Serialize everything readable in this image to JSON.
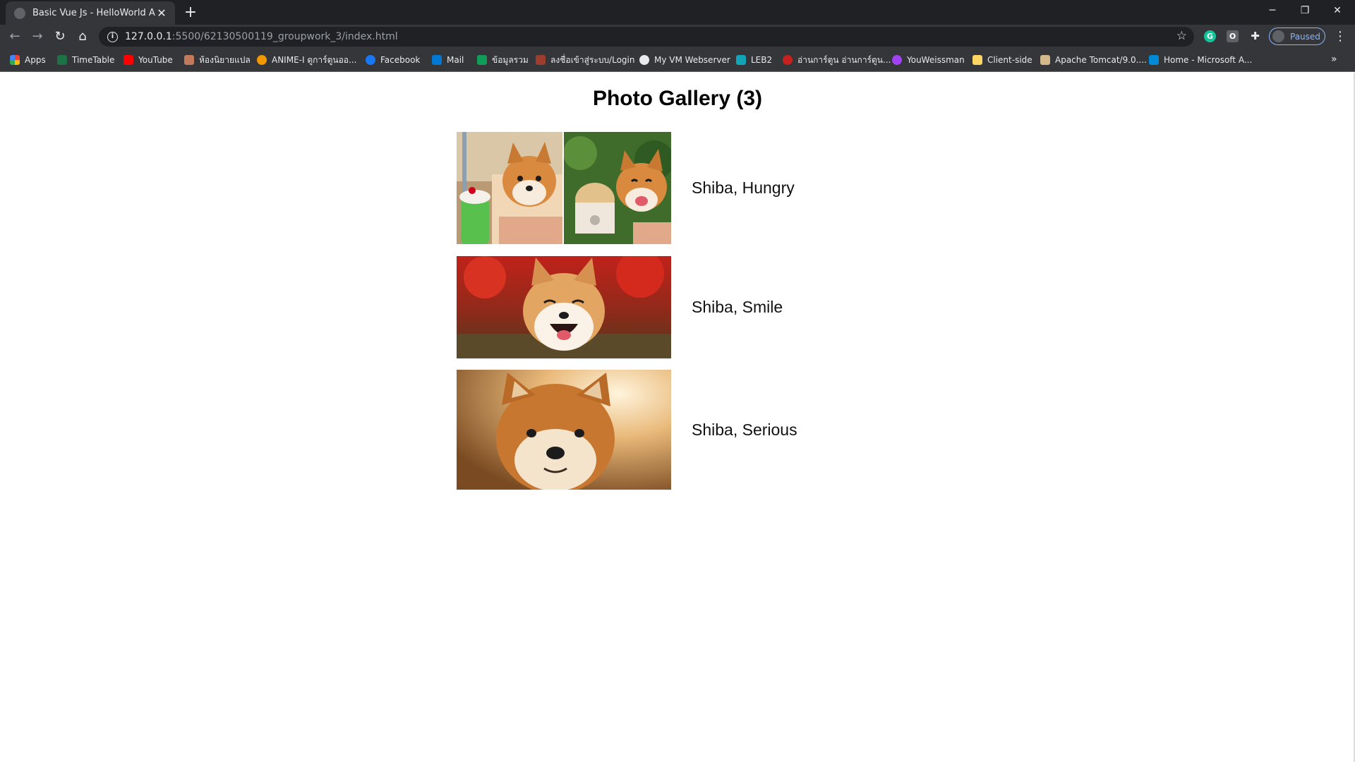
{
  "browser": {
    "tab_title": "Basic Vue Js - HelloWorld App",
    "url_host": "127.0.0.1",
    "url_path": ":5500/62130500119_groupwork_3/index.html",
    "profile_label": "Paused"
  },
  "bookmarks": [
    {
      "label": "Apps",
      "icon": "apps-grid-icon",
      "color": "#ea4335"
    },
    {
      "label": "TimeTable",
      "icon": "excel-icon",
      "color": "#1e7145"
    },
    {
      "label": "YouTube",
      "icon": "youtube-icon",
      "color": "#ff0000"
    },
    {
      "label": "ห้องนิยายแปล",
      "icon": "novel-icon",
      "color": "#c27b5a"
    },
    {
      "label": "ANIME-I ดูการ์ตูนออ...",
      "icon": "anime-icon",
      "color": "#f29900"
    },
    {
      "label": "Facebook",
      "icon": "facebook-icon",
      "color": "#1877f2"
    },
    {
      "label": "Mail",
      "icon": "outlook-icon",
      "color": "#0078d4"
    },
    {
      "label": "ข้อมูลรวม",
      "icon": "sheets-icon",
      "color": "#0f9d58"
    },
    {
      "label": "ลงชื่อเข้าสู่ระบบ/Login",
      "icon": "login-icon",
      "color": "#9c3d2e"
    },
    {
      "label": "My VM Webserver",
      "icon": "globe-icon",
      "color": "#e8eaed"
    },
    {
      "label": "LEB2",
      "icon": "leb2-icon",
      "color": "#12a5b8"
    },
    {
      "label": "อ่านการ์ตูน อ่านการ์ตูน...",
      "icon": "manga-icon",
      "color": "#c5221f"
    },
    {
      "label": "YouWeissman",
      "icon": "youweissman-icon",
      "color": "#a142f4"
    },
    {
      "label": "Client-side",
      "icon": "folder-icon",
      "color": "#fdd663"
    },
    {
      "label": "Apache Tomcat/9.0....",
      "icon": "tomcat-icon",
      "color": "#d3b88c"
    },
    {
      "label": "Home - Microsoft A...",
      "icon": "azure-icon",
      "color": "#0089d6"
    }
  ],
  "gallery": {
    "title": "Photo Gallery (3)",
    "photos": [
      {
        "caption": "Shiba, Hungry"
      },
      {
        "caption": "Shiba, Smile"
      },
      {
        "caption": "Shiba, Serious"
      }
    ]
  }
}
